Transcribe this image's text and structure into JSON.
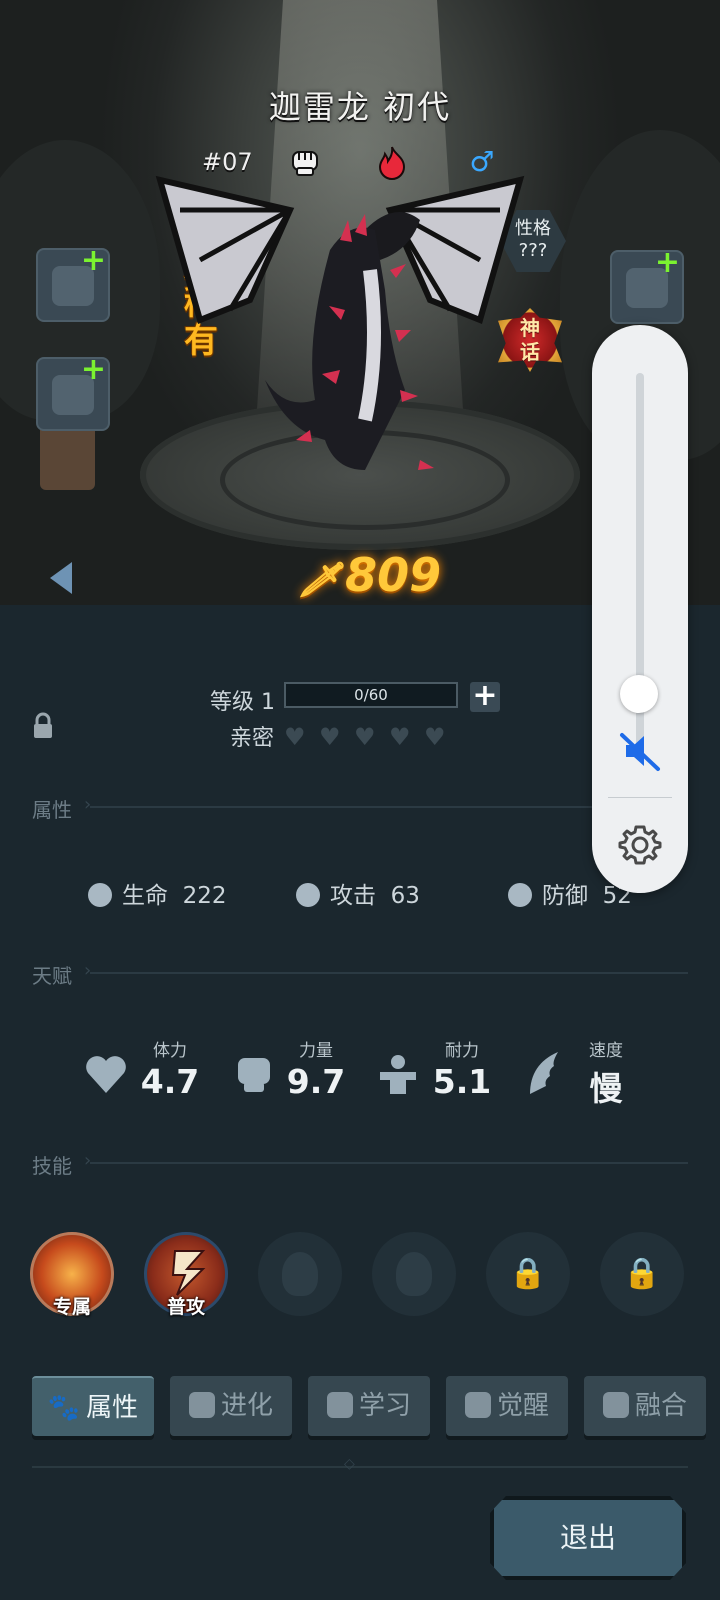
{
  "header": {
    "title": "迦雷龙 初代",
    "number": "#07",
    "gender_symbol": "♂",
    "rarity": "超稀有",
    "personality_label": "性格",
    "personality_value": "???",
    "mythic_badge": "神话"
  },
  "power": {
    "value": "809"
  },
  "level": {
    "label": "等级 1",
    "xp": "0/60",
    "plus": "+"
  },
  "affection": {
    "label": "亲密",
    "hearts_filled": 0,
    "hearts_total": 5
  },
  "sections": {
    "attributes": "属性",
    "talents": "天赋",
    "skills": "技能"
  },
  "stats": [
    {
      "label": "生命",
      "value": "222"
    },
    {
      "label": "攻击",
      "value": "63"
    },
    {
      "label": "防御",
      "value": "52"
    }
  ],
  "talents": [
    {
      "label": "体力",
      "value": "4.7"
    },
    {
      "label": "力量",
      "value": "9.7"
    },
    {
      "label": "耐力",
      "value": "5.1"
    },
    {
      "label": "速度",
      "value": "慢"
    }
  ],
  "skills": [
    {
      "tag": "专属",
      "state": "active"
    },
    {
      "tag": "普攻",
      "state": "active"
    },
    {
      "tag": "",
      "state": "empty"
    },
    {
      "tag": "",
      "state": "empty"
    },
    {
      "tag": "",
      "state": "locked"
    },
    {
      "tag": "",
      "state": "locked"
    }
  ],
  "tabs": [
    {
      "label": "属性",
      "selected": true
    },
    {
      "label": "进化",
      "selected": false
    },
    {
      "label": "学习",
      "selected": false
    },
    {
      "label": "觉醒",
      "selected": false
    },
    {
      "label": "融合",
      "selected": false
    }
  ],
  "exit_label": "退出",
  "volume_panel": {
    "level": 0.08,
    "muted": true
  },
  "colors": {
    "power": "#ffc83a",
    "rarity": "#ffb820",
    "plus_green": "#7bf230",
    "mute_blue": "#1e6be8",
    "gender_blue": "#3aa8ff",
    "fire_red": "#e8283a"
  }
}
